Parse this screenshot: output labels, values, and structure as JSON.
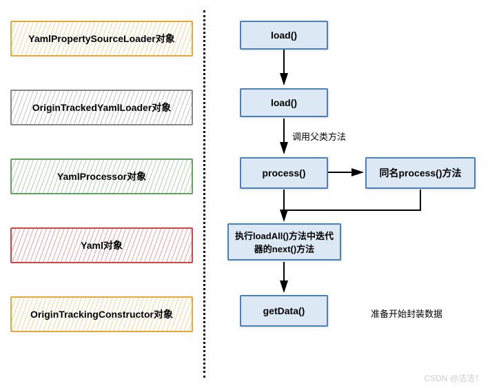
{
  "left_boxes": [
    {
      "label": "YamlPropertySourceLoader对象"
    },
    {
      "label": "OriginTrackedYamlLoader对象"
    },
    {
      "label": "YamlProcessor对象"
    },
    {
      "label": "Yaml对象"
    },
    {
      "label": "OriginTrackingConstructor对象"
    }
  ],
  "flow": {
    "n1": "load()",
    "n2": "load()",
    "n3": "process()",
    "n4": "同名process()方法",
    "n5": "执行loadAll()方法中迭代器的next()方法",
    "n6": "getData()"
  },
  "labels": {
    "l1": "调用父类方法",
    "l2": "准备开始封装数据"
  },
  "watermark": "CSDN @洁洁！"
}
